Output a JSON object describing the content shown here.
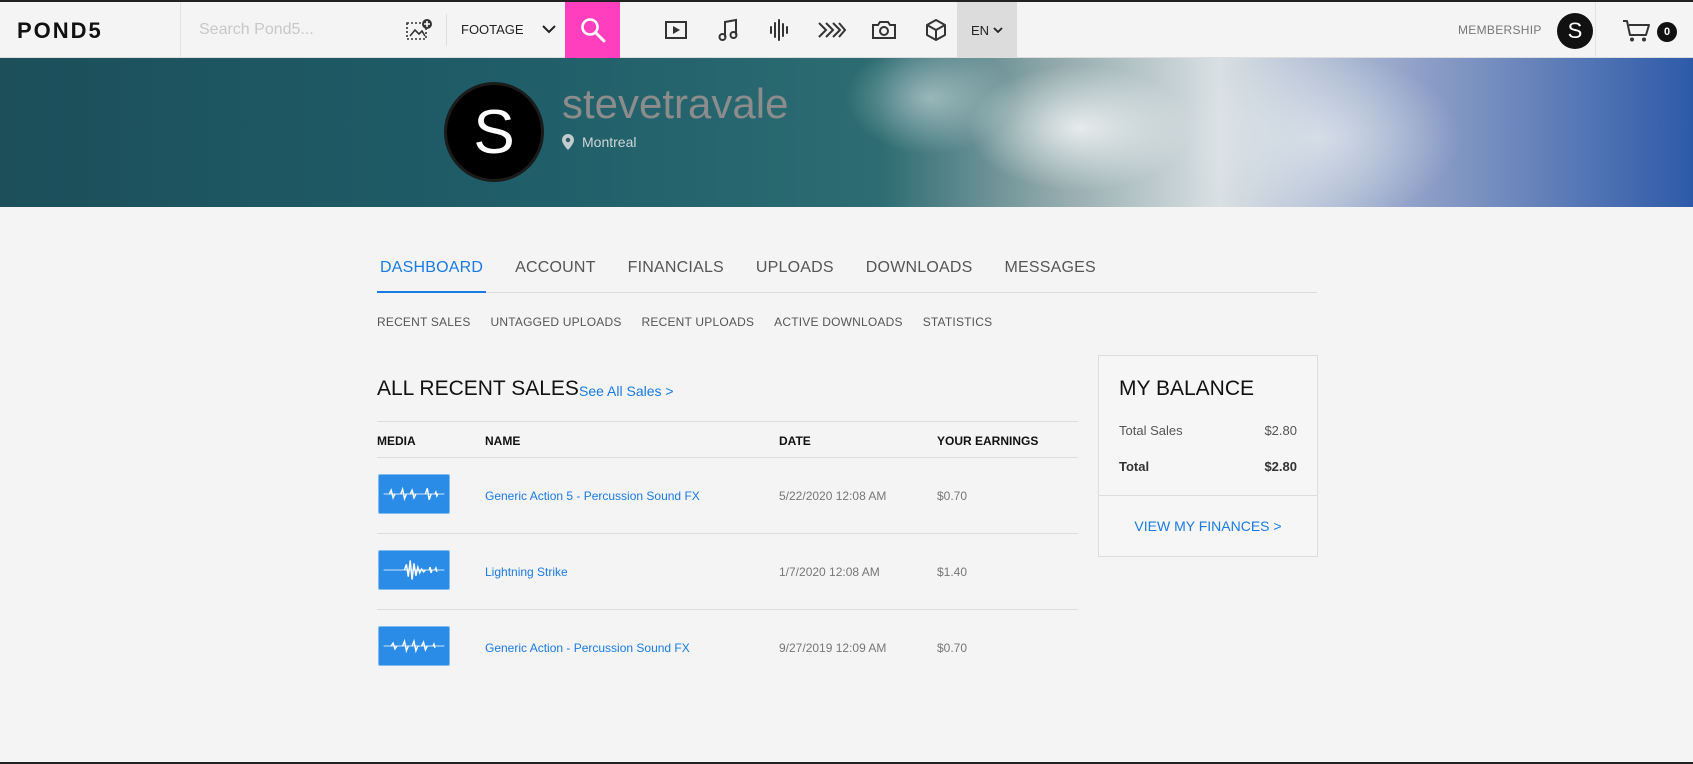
{
  "header": {
    "logo": "POND5",
    "search_placeholder": "Search Pond5...",
    "category": "FOOTAGE",
    "media_icons": [
      "video-icon",
      "music-icon",
      "sound-fx-icon",
      "after-effects-icon",
      "photo-icon",
      "3d-icon"
    ],
    "language": "EN",
    "membership": "MEMBERSHIP",
    "avatar_letter": "S",
    "cart_count": "0",
    "accent_color": "#ff3fbd"
  },
  "profile": {
    "avatar_letter": "S",
    "username": "stevetravale",
    "location": "Montreal"
  },
  "tabs": [
    {
      "label": "DASHBOARD",
      "active": true
    },
    {
      "label": "ACCOUNT"
    },
    {
      "label": "FINANCIALS"
    },
    {
      "label": "UPLOADS"
    },
    {
      "label": "DOWNLOADS"
    },
    {
      "label": "MESSAGES"
    }
  ],
  "subtabs": [
    "RECENT SALES",
    "UNTAGGED UPLOADS",
    "RECENT UPLOADS",
    "ACTIVE DOWNLOADS",
    "STATISTICS"
  ],
  "sales": {
    "title": "ALL RECENT SALES",
    "see_all": "See All Sales >",
    "columns": [
      "MEDIA",
      "NAME",
      "DATE",
      "YOUR EARNINGS"
    ],
    "rows": [
      {
        "name": "Generic Action 5 - Percussion Sound FX",
        "date": "5/22/2020 12:08 AM",
        "earnings": "$0.70"
      },
      {
        "name": "Lightning Strike",
        "date": "1/7/2020 12:08 AM",
        "earnings": "$1.40"
      },
      {
        "name": "Generic Action - Percussion Sound FX",
        "date": "9/27/2019 12:09 AM",
        "earnings": "$0.70"
      }
    ]
  },
  "balance": {
    "title": "MY BALANCE",
    "total_sales_label": "Total Sales",
    "total_sales_value": "$2.80",
    "total_label": "Total",
    "total_value": "$2.80",
    "view_finances": "VIEW MY FINANCES >"
  }
}
